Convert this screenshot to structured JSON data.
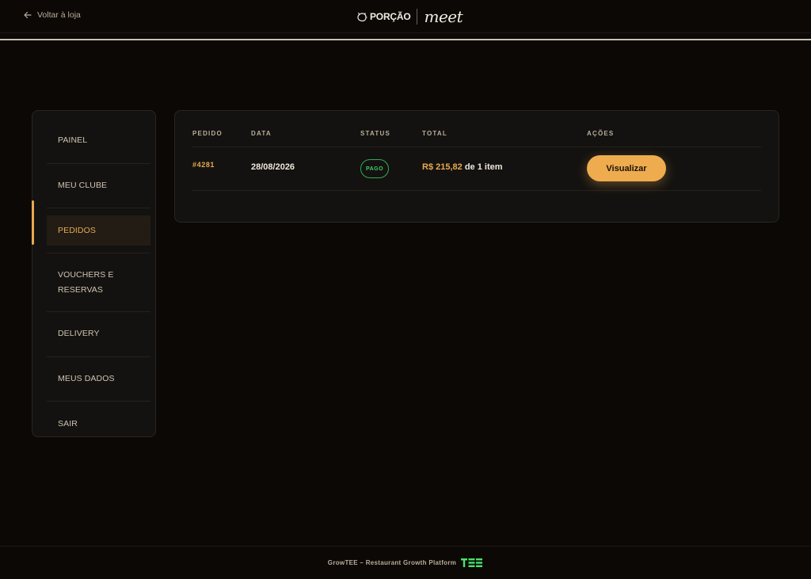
{
  "header": {
    "back_label": "Voltar à loja",
    "logo_brand": "PORÇÃO",
    "logo_sub": "meet"
  },
  "sidebar": {
    "items": [
      {
        "label": "PAINEL",
        "active": false
      },
      {
        "label": "MEU CLUBE",
        "active": false
      },
      {
        "label": "PEDIDOS",
        "active": true
      },
      {
        "label": "VOUCHERS E RESERVAS",
        "active": false
      },
      {
        "label": "DELIVERY",
        "active": false
      },
      {
        "label": "MEUS DADOS",
        "active": false
      },
      {
        "label": "SAIR",
        "active": false
      }
    ]
  },
  "orders": {
    "columns": [
      "PEDIDO",
      "DATA",
      "STATUS",
      "TOTAL",
      "AÇÕES"
    ],
    "rows": [
      {
        "id": "#4281",
        "date": "28/08/2026",
        "status": "PAGO",
        "total_amount": "R$ 215,82",
        "total_suffix": "de 1 item",
        "action_label": "Visualizar"
      }
    ]
  },
  "footer": {
    "text": "GrowTEE – Restaurant Growth Platform"
  },
  "colors": {
    "accent": "#eeac4f",
    "status_paid": "#3ccf6a",
    "background": "#0b0806",
    "panel": "#141210"
  }
}
